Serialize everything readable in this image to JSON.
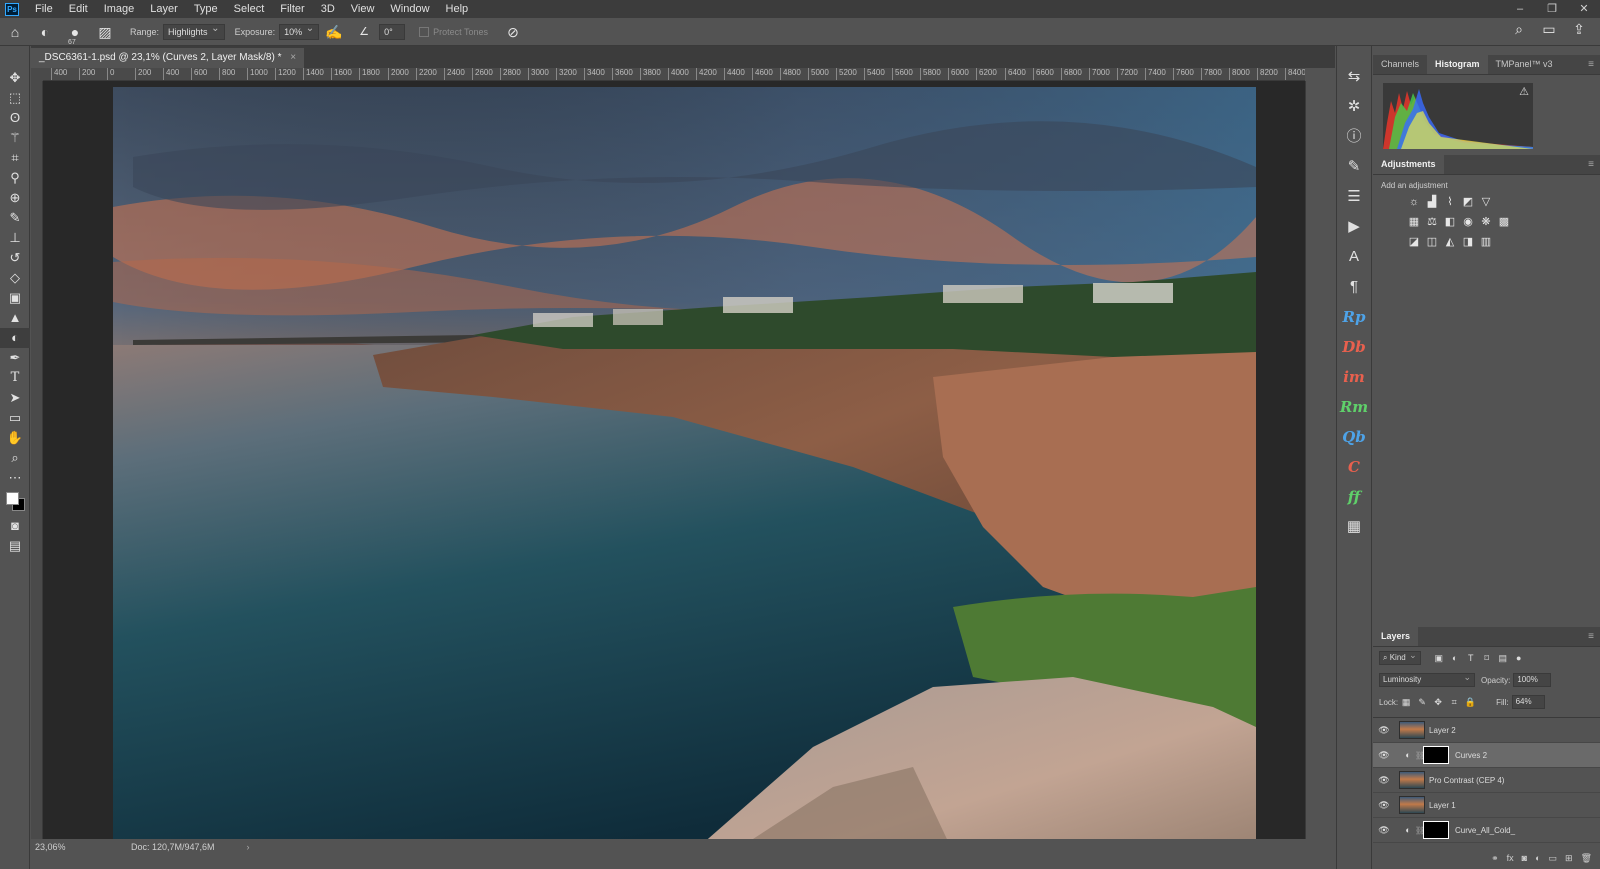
{
  "menu": {
    "logo": "Ps",
    "items": [
      "File",
      "Edit",
      "Image",
      "Layer",
      "Type",
      "Select",
      "Filter",
      "3D",
      "View",
      "Window",
      "Help"
    ]
  },
  "window_controls": [
    "–",
    "❐",
    "✕"
  ],
  "options_bar": {
    "brush_size": "67",
    "range_label": "Range:",
    "range_value": "Highlights",
    "exposure_label": "Exposure:",
    "exposure_value": "10%",
    "angle_value": "0°",
    "protect_tones": "Protect Tones"
  },
  "document": {
    "tab_title": "_DSC6361-1.psd @ 23,1% (Curves 2, Layer Mask/8) *",
    "close_glyph": "×"
  },
  "ruler": {
    "labels": [
      "400",
      "200",
      "0",
      "200",
      "400",
      "600",
      "800",
      "1000",
      "1200",
      "1400",
      "1600",
      "1800",
      "2000",
      "2200",
      "2400",
      "2600",
      "2800",
      "3000",
      "3200",
      "3400",
      "3600",
      "3800",
      "4000",
      "4200",
      "4400",
      "4600",
      "4800",
      "5000",
      "5200",
      "5400",
      "5600",
      "5800",
      "6000",
      "6200",
      "6400",
      "6600",
      "6800",
      "7000",
      "7200",
      "7400",
      "7600",
      "7800",
      "8000",
      "8200",
      "8400"
    ]
  },
  "status": {
    "zoom": "23,06%",
    "doc_size": "Doc: 120,7M/947,6M",
    "arrow": "›"
  },
  "icon_strip": {
    "plugins": [
      {
        "label": "Rp",
        "color": "#4ea3e8"
      },
      {
        "label": "Db",
        "color": "#e8604e"
      },
      {
        "label": "im",
        "color": "#e8604e"
      },
      {
        "label": "Rm",
        "color": "#5fd06a"
      },
      {
        "label": "Qb",
        "color": "#4ea3e8"
      },
      {
        "label": "C",
        "color": "#e8604e"
      },
      {
        "label": "ff",
        "color": "#5fd06a"
      }
    ]
  },
  "top_panel": {
    "tabs": [
      "Channels",
      "Histogram",
      "TMPanel™ v3"
    ],
    "active_tab": "Histogram",
    "warning_glyph": "⚠"
  },
  "adjustments": {
    "title": "Adjustments",
    "hint": "Add an adjustment"
  },
  "layers": {
    "title": "Layers",
    "kind_filter": "Kind",
    "blend_mode": "Luminosity",
    "opacity_label": "Opacity:",
    "opacity_value": "100%",
    "lock_label": "Lock:",
    "fill_label": "Fill:",
    "fill_value": "64%",
    "items": [
      {
        "name": "Layer 2",
        "type": "pixel",
        "selected": false
      },
      {
        "name": "Curves 2",
        "type": "adjustment",
        "selected": true
      },
      {
        "name": "Pro Contrast (CEP 4)",
        "type": "pixel",
        "selected": false
      },
      {
        "name": "Layer 1",
        "type": "pixel",
        "selected": false
      },
      {
        "name": "Curve_All_Cold_",
        "type": "adjustment",
        "selected": false
      }
    ]
  },
  "colors": {
    "app_bg": "#535353",
    "menubar_bg": "#3c3c3c",
    "canvas_bg": "#282828",
    "accent_blue": "#31a8ff"
  }
}
